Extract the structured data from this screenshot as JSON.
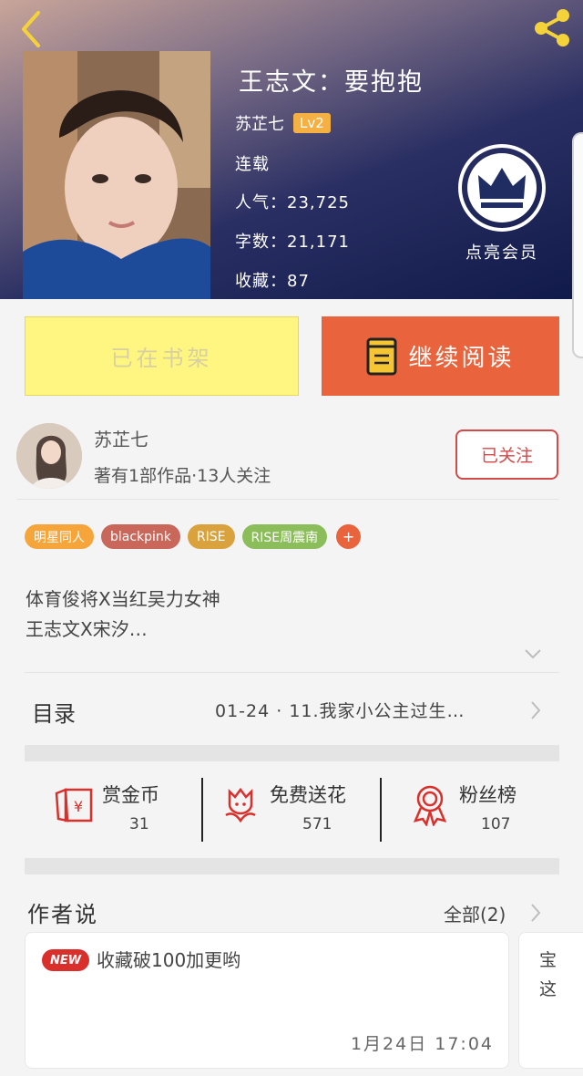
{
  "header": {
    "title": "王志文：要抱抱",
    "author": "苏芷七",
    "level": "Lv2",
    "status": "连载",
    "popularity": "人气：23,725",
    "word_count": "字数：21,171",
    "favorites": "收藏：87",
    "vip_label": "点亮会员"
  },
  "actions": {
    "shelf_label": "已在书架",
    "read_label": "继续阅读"
  },
  "author": {
    "name": "苏芷七",
    "meta": "著有1部作品·13人关注",
    "follow_label": "已关注"
  },
  "tags": [
    {
      "label": "明星同人",
      "color": "#f5a53a"
    },
    {
      "label": "blackpink",
      "color": "#c9675a"
    },
    {
      "label": "RISE",
      "color": "#d9a23d"
    },
    {
      "label": "RISE周震南",
      "color": "#8bbd5a"
    }
  ],
  "tag_more": "+",
  "description": {
    "line1": "体育俊将X当红吴力女神",
    "line2": "王志文X宋汐…"
  },
  "catalog": {
    "label": "目录",
    "latest": "01-24 · 11.我家小公主过生…"
  },
  "stats": {
    "reward": {
      "label": "赏金币",
      "value": "31"
    },
    "flower": {
      "label": "免费送花",
      "value": "571"
    },
    "fans": {
      "label": "粉丝榜",
      "value": "107"
    }
  },
  "author_says": {
    "title": "作者说",
    "all_label": "全部(2)",
    "cards": [
      {
        "badge": "NEW",
        "text": "收藏破100加更哟",
        "time": "1月24日 17:04"
      },
      {
        "text": "宝这"
      }
    ]
  },
  "colors": {
    "accent": "#e9643c",
    "shelf_bg": "#fef680",
    "follow": "#d24a4a",
    "stat_icon": "#d9302c"
  }
}
